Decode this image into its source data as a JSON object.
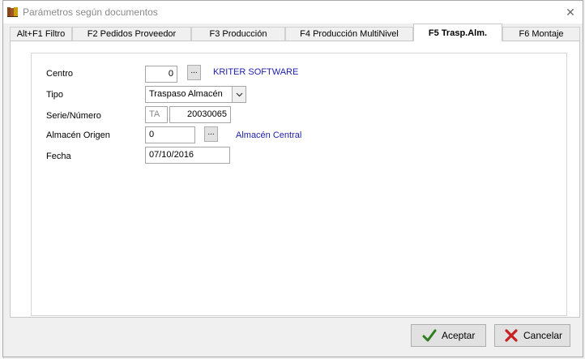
{
  "window": {
    "title": "Parámetros según documentos",
    "close_symbol": "✕"
  },
  "tabs": [
    {
      "label": "Alt+F1 Filtro"
    },
    {
      "label": "F2 Pedidos Proveedor"
    },
    {
      "label": "F3 Producción"
    },
    {
      "label": "F4 Producción MultiNivel"
    },
    {
      "label": "F5 Trasp.Alm."
    },
    {
      "label": "F6 Montaje"
    }
  ],
  "form": {
    "centro": {
      "label": "Centro",
      "value": "0",
      "lookup": "...",
      "description": "KRITER SOFTWARE"
    },
    "tipo": {
      "label": "Tipo",
      "value": "Traspaso Almacén"
    },
    "serie_numero": {
      "label": "Serie/Número",
      "serie": "TA",
      "numero": "20030065"
    },
    "almacen_origen": {
      "label": "Almacén Origen",
      "value": "0",
      "lookup": "...",
      "description": "Almacén Central"
    },
    "fecha": {
      "label": "Fecha",
      "value": "07/10/2016"
    }
  },
  "buttons": {
    "accept": {
      "label": "Aceptar",
      "icon": "check-icon"
    },
    "cancel": {
      "label": "Cancelar",
      "icon": "cross-icon"
    }
  },
  "colors": {
    "link": "#1e1ea8",
    "accept_icon": "#2e7d1e",
    "cancel_icon": "#c62020"
  }
}
